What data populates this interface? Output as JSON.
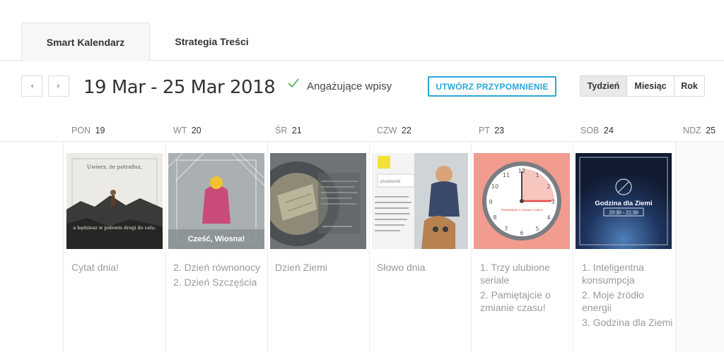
{
  "tabs": [
    {
      "label": "Smart Kalendarz",
      "active": true
    },
    {
      "label": "Strategia Treści",
      "active": false
    }
  ],
  "toolbar": {
    "date_range": "19 Mar - 25 Mar 2018",
    "checkbox_label": "Angażujące wpisy",
    "checkbox_checked": true,
    "reminder_button": "UTWÓRZ PRZYPOMNIENIE",
    "views": [
      "Tydzień",
      "Miesiąc",
      "Rok"
    ],
    "active_view": "Tydzień"
  },
  "days": [
    {
      "abbr": "PON",
      "num": "19",
      "items": [
        "Cytat dnia!"
      ],
      "thumb_text": {
        "top": "Uwierz, że potrafisz,",
        "bottom": "a będziesz w połowie drogi do celu."
      }
    },
    {
      "abbr": "WT",
      "num": "20",
      "items": [
        "2. Dzień równonocy",
        "2. Dzień Szczęścia"
      ],
      "thumb_text": {
        "caption": "Cześć, Wiosna!"
      }
    },
    {
      "abbr": "ŚR",
      "num": "21",
      "items": [
        "Dzień Ziemi"
      ]
    },
    {
      "abbr": "CZW",
      "num": "22",
      "items": [
        "Słowo dnia"
      ],
      "thumb_text": {
        "word": "phubbomb",
        "desc": "Phubbomb – nieoczekiwane znalezienie się na zdjęciu zupełnie przez przypadek"
      }
    },
    {
      "abbr": "PT",
      "num": "23",
      "items": [
        "1. Trzy ulubione seriale",
        "2. Pamiętajcie o zmianie czasu!"
      ],
      "thumb_text": {
        "clock_note": "Pamiętajcie o zmianie czasu!"
      }
    },
    {
      "abbr": "SOB",
      "num": "24",
      "items": [
        "1. Inteligentna konsumpcja",
        "2. Moje źródło energii",
        "3. Godzina dla Ziemi"
      ],
      "thumb_text": {
        "title": "Godzina dla Ziemi",
        "time": "20:30 - 21:30"
      }
    },
    {
      "abbr": "NDZ",
      "num": "25",
      "items": []
    }
  ],
  "colors": {
    "accent": "#2aa7d8",
    "check": "#4caf50",
    "clock_bg": "#f29b8f",
    "clock_hand": "#e24b4b"
  }
}
